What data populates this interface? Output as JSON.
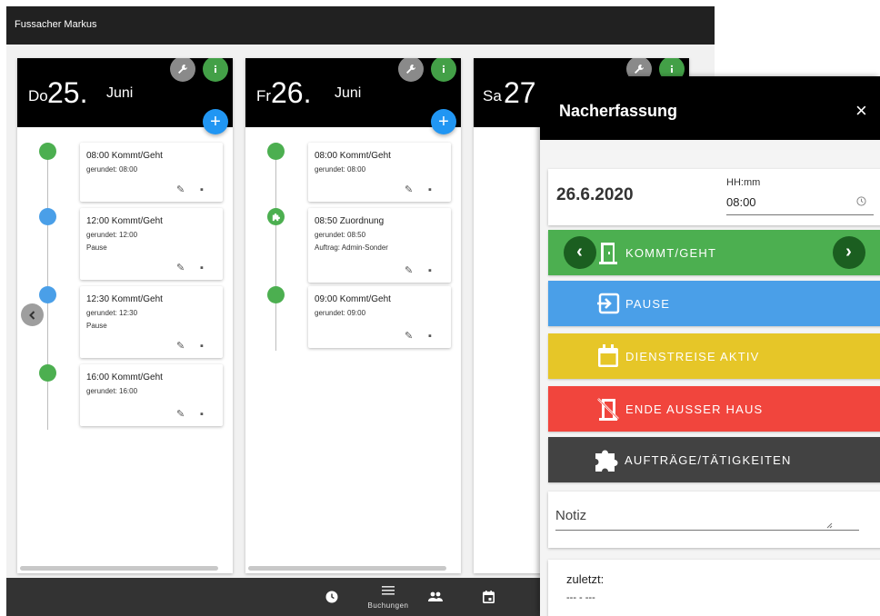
{
  "app": {
    "user_name": "Fussacher Markus"
  },
  "days": [
    {
      "dow": "Do",
      "day": "25.",
      "month": "Juni",
      "entries": [
        {
          "title": "08:00 Kommt/Geht",
          "rounded": "gerundet: 08:00",
          "extra": ""
        },
        {
          "title": "12:00 Kommt/Geht",
          "rounded": "gerundet: 12:00",
          "extra": "Pause"
        },
        {
          "title": "12:30 Kommt/Geht",
          "rounded": "gerundet: 12:30",
          "extra": "Pause"
        },
        {
          "title": "16:00 Kommt/Geht",
          "rounded": "gerundet: 16:00",
          "extra": ""
        }
      ]
    },
    {
      "dow": "Fr",
      "day": "26.",
      "month": "Juni",
      "entries": [
        {
          "title": "08:00 Kommt/Geht",
          "rounded": "gerundet: 08:00",
          "extra": ""
        },
        {
          "title": "08:50 Zuordnung",
          "rounded": "gerundet: 08:50",
          "extra": "Auftrag: Admin-Sonder"
        },
        {
          "title": "09:00 Kommt/Geht",
          "rounded": "gerundet: 09:00",
          "extra": ""
        }
      ]
    },
    {
      "dow": "Sa",
      "day": "27",
      "month": ""
    }
  ],
  "bottom_nav": {
    "bookings_label": "Buchungen"
  },
  "panel": {
    "title": "Nacherfassung",
    "close": "×",
    "date": "26.6.2020",
    "time_label": "HH:mm",
    "time_value": "08:00",
    "buttons": {
      "kommt_geht": "KOMMT/GEHT",
      "pause": "PAUSE",
      "dienstreise": "DIENSTREISE AKTIV",
      "ende_ausser_haus": "ENDE AUSSER HAUS",
      "auftraege": "AUFTRÄGE/TÄTIGKEITEN"
    },
    "note_placeholder": "Notiz",
    "last_label": "zuletzt:",
    "last_value": "--- - ---"
  },
  "colors": {
    "green": "#4caf50",
    "blue": "#4a9fe8",
    "yellow": "#e6c628",
    "red": "#f1453d",
    "dark": "#424242",
    "fab": "#2196f3"
  }
}
